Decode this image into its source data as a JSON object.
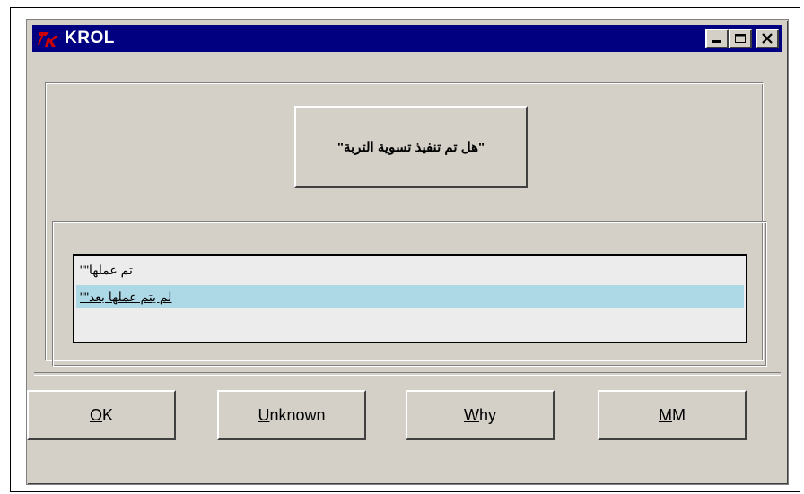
{
  "window": {
    "title": "KROL",
    "controls": [
      "minimize-icon",
      "maximize-icon",
      "close-icon"
    ]
  },
  "question": {
    "text": "\"هل تم تنفيذ تسوية التربة\""
  },
  "listbox": {
    "items": [
      {
        "label": "تم عملها\"\"",
        "selected": false
      },
      {
        "label": "لم يتم عملها بعد\"\"",
        "selected": true
      }
    ]
  },
  "buttons": {
    "ok": {
      "mnemonic": "O",
      "rest": "K"
    },
    "unknown": {
      "mnemonic": "U",
      "rest": "nknown"
    },
    "why": {
      "mnemonic": "W",
      "rest": "hy"
    },
    "mm": {
      "mnemonic": "M",
      "rest": "M"
    }
  },
  "colors": {
    "titlebar": "#000080",
    "window_bg": "#d4d0c8",
    "selection": "#add8e6",
    "tk_icon": "#cc0000"
  }
}
